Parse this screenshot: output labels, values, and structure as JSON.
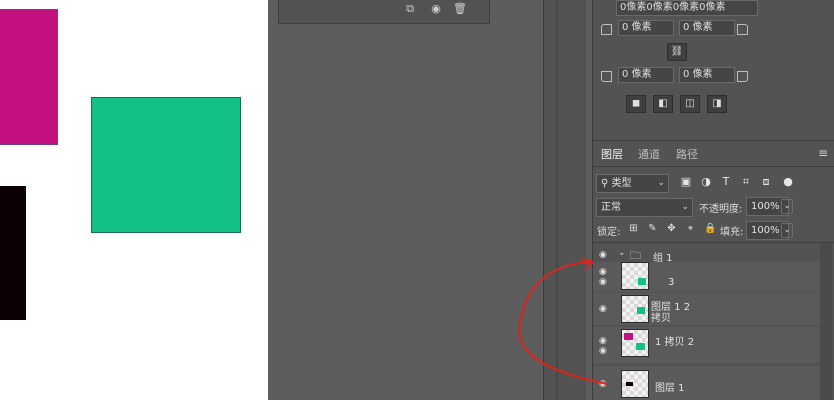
{
  "colors": {
    "magenta": "#c2117f",
    "green": "#13c185",
    "black": "#0b0006",
    "panel": "#535353",
    "highlight": "#4a9ed6",
    "annotation": "#d9261c"
  },
  "properties": {
    "top_field": "0像素0像素0像素0像素",
    "corner_tl": "0 像素",
    "corner_tr": "0 像素",
    "corner_bl": "0 像素",
    "corner_br": "0 像素"
  },
  "tabs": [
    {
      "label": "图层"
    },
    {
      "label": "通道"
    },
    {
      "label": "路径"
    }
  ],
  "filter": {
    "kind_label": "类型"
  },
  "blend": {
    "mode": "正常",
    "opacity_label": "不透明度:",
    "opacity": "100%"
  },
  "lock": {
    "label": "锁定:",
    "fill_label": "填充:",
    "fill": "100%"
  },
  "layers": [
    {
      "name": "组 1",
      "kind": "group"
    },
    {
      "name": "3",
      "kind": "layer"
    },
    {
      "name": "图层 1 2 拷贝",
      "kind": "layer"
    },
    {
      "name": "1 拷贝 2",
      "kind": "layer"
    },
    {
      "name": "图层 1",
      "kind": "layer"
    }
  ],
  "icons": {
    "panel_menu": "hamburger-menu-icon",
    "visibility": "eye-icon",
    "folder": "folder-icon",
    "link": "link-icon"
  }
}
